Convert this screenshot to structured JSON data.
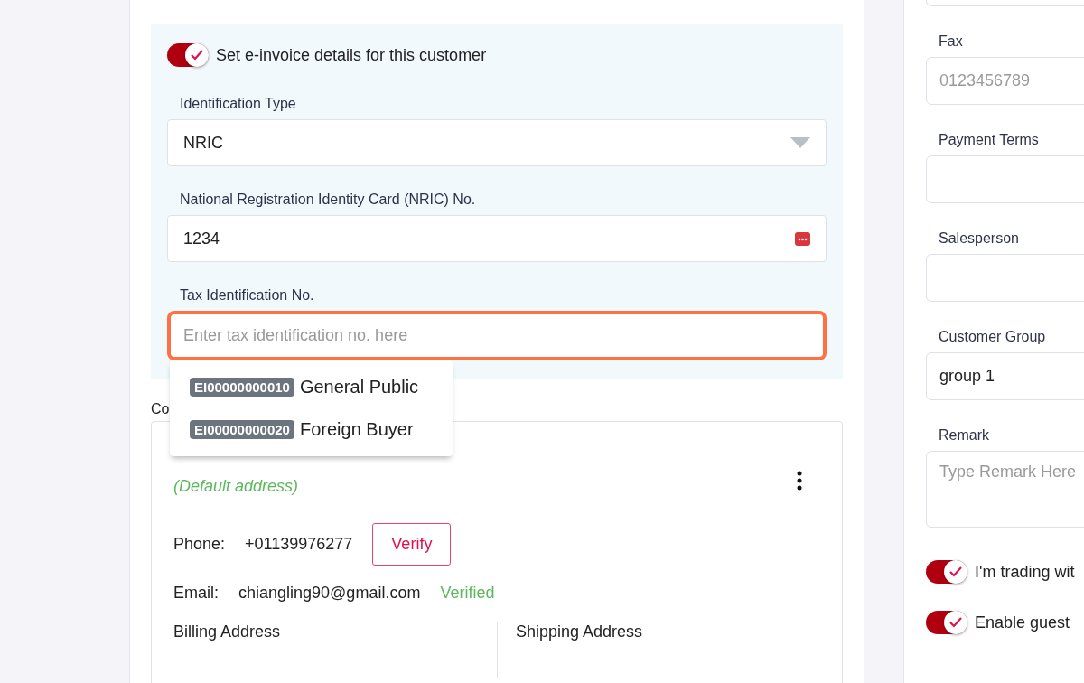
{
  "einvoice": {
    "toggle": {
      "label": "Set e-invoice details for this customer",
      "on": true
    },
    "identification_type": {
      "label": "Identification Type",
      "value": "NRIC"
    },
    "nric": {
      "label": "National Registration Identity Card (NRIC) No.",
      "value": "1234"
    },
    "tax_id": {
      "label": "Tax Identification No.",
      "placeholder": "Enter tax identification no. here",
      "focused": true,
      "suggestions": [
        {
          "code": "EI00000000010",
          "name": "General Public"
        },
        {
          "code": "EI00000000020",
          "name": "Foreign Buyer"
        }
      ]
    }
  },
  "contact_section": {
    "title": "Co",
    "default_address": "(Default address)",
    "phone": {
      "label": "Phone:",
      "value": "+01139976277",
      "action": "Verify"
    },
    "email": {
      "label": "Email:",
      "value": "chiangling90@gmail.com",
      "status": "Verified"
    },
    "columns": [
      "Billing Address",
      "Shipping Address"
    ]
  },
  "side": {
    "fields": [
      {
        "kind": "input",
        "label": "Fax",
        "placeholder": "0123456789"
      },
      {
        "kind": "input",
        "label": "Payment Terms"
      },
      {
        "kind": "input",
        "label": "Salesperson"
      },
      {
        "kind": "input",
        "label": "Customer Group",
        "value": "group 1"
      },
      {
        "kind": "textarea",
        "label": "Remark",
        "placeholder": "Type Remark Here"
      }
    ],
    "toggles": [
      {
        "label": "I'm trading wit",
        "on": true
      },
      {
        "label": "Enable guest",
        "on": true
      }
    ]
  }
}
